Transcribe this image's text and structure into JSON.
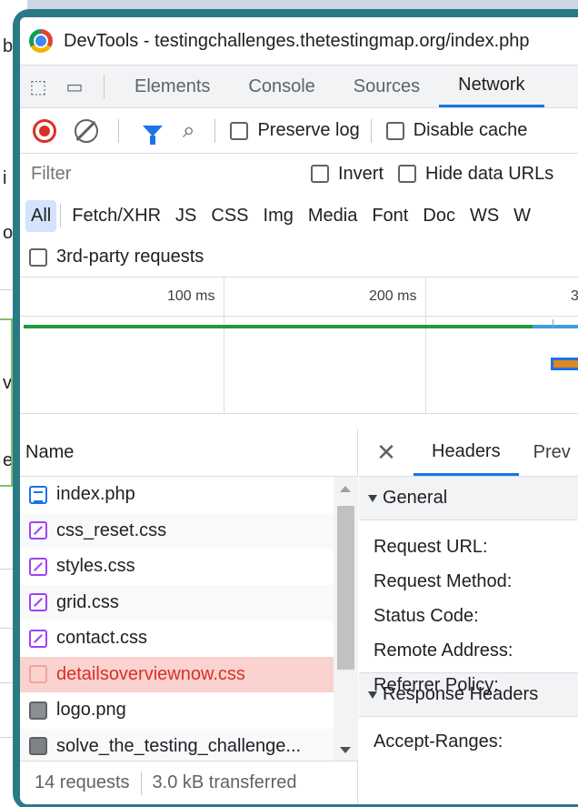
{
  "window": {
    "title": "DevTools - testingchallenges.thetestingmap.org/index.php"
  },
  "tabs": {
    "elements": "Elements",
    "console": "Console",
    "sources": "Sources",
    "network": "Network"
  },
  "toolbar": {
    "preserve_log": "Preserve log",
    "disable_cache": "Disable cache"
  },
  "filter": {
    "placeholder": "Filter",
    "invert": "Invert",
    "hide_data_urls": "Hide data URLs"
  },
  "types": [
    "All",
    "Fetch/XHR",
    "JS",
    "CSS",
    "Img",
    "Media",
    "Font",
    "Doc",
    "WS",
    "W"
  ],
  "third_party": "3rd-party requests",
  "overview": {
    "ticks": [
      "100 ms",
      "200 ms",
      "3"
    ]
  },
  "requests": {
    "header": "Name",
    "rows": [
      {
        "name": "index.php",
        "icon": "document-icon",
        "error": false
      },
      {
        "name": "css_reset.css",
        "icon": "stylesheet-icon",
        "error": false
      },
      {
        "name": "styles.css",
        "icon": "stylesheet-icon",
        "error": false
      },
      {
        "name": "grid.css",
        "icon": "stylesheet-icon",
        "error": false
      },
      {
        "name": "contact.css",
        "icon": "stylesheet-icon",
        "error": false
      },
      {
        "name": "detailsoverviewnow.css",
        "icon": "stylesheet-icon",
        "error": true
      },
      {
        "name": "logo.png",
        "icon": "image-icon",
        "error": false
      },
      {
        "name": "solve_the_testing_challenge...",
        "icon": "file-icon",
        "error": false
      }
    ]
  },
  "status": {
    "requests": "14 requests",
    "transferred": "3.0 kB transferred"
  },
  "details": {
    "tabs": [
      "Headers",
      "Prev"
    ],
    "general_title": "General",
    "general_keys": [
      "Request URL:",
      "Request Method:",
      "Status Code:",
      "Remote Address:",
      "Referrer Policy:"
    ],
    "response_title": "Response Headers",
    "response_keys": [
      "Accept-Ranges:"
    ]
  },
  "colors": {
    "accent": "#1a73e8",
    "error_bg": "#fad2cf",
    "error_text": "#d93025",
    "frame": "#2a7a86"
  }
}
